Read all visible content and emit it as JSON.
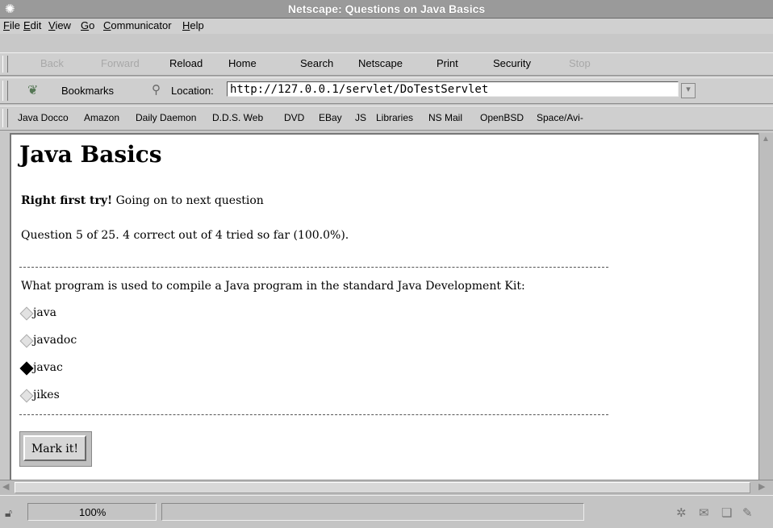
{
  "window": {
    "title": "Netscape: Questions on Java Basics"
  },
  "menu": [
    "File",
    "Edit",
    "View",
    "Go",
    "Communicator",
    "Help"
  ],
  "nav_buttons": [
    {
      "label": "Back",
      "enabled": false
    },
    {
      "label": "Forward",
      "enabled": false
    },
    {
      "label": "Reload",
      "enabled": true
    },
    {
      "label": "Home",
      "enabled": true
    },
    {
      "label": "Search",
      "enabled": true
    },
    {
      "label": "Netscape",
      "enabled": true
    },
    {
      "label": "Print",
      "enabled": true
    },
    {
      "label": "Security",
      "enabled": true
    },
    {
      "label": "Stop",
      "enabled": false
    }
  ],
  "location_bar": {
    "bookmarks_label": "Bookmarks",
    "location_label": "Location:",
    "url": "http://127.0.0.1/servlet/DoTestServlet"
  },
  "personal_toolbar": [
    "Java Docco",
    "Amazon",
    "Daily Daemon",
    "D.D.S. Web",
    "DVD",
    "EBay",
    "JS",
    "Libraries",
    "NS Mail",
    "OpenBSD",
    "Space/Avi-"
  ],
  "page": {
    "heading": "Java Basics",
    "feedback_bold": "Right first try!",
    "feedback_text": " Going on to next question",
    "progress": "Question 5 of 25. 4 correct out of 4 tried so far (100.0%).",
    "question": "What program is used to compile a Java program in the standard Java Development Kit:",
    "options": [
      {
        "label": "java",
        "selected": false
      },
      {
        "label": "javadoc",
        "selected": false
      },
      {
        "label": "javac",
        "selected": true
      },
      {
        "label": "jikes",
        "selected": false
      }
    ],
    "submit_label": "Mark it!"
  },
  "status": {
    "zoom": "100%"
  }
}
